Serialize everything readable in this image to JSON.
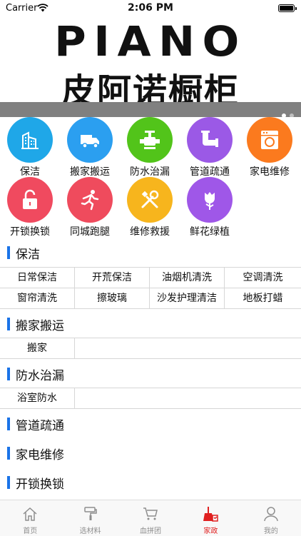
{
  "status": {
    "carrier": "Carrier",
    "time": "2:06 PM"
  },
  "banner": {
    "brand": "PIANO",
    "subtitle": "皮阿诺橱柜"
  },
  "services": [
    {
      "label": "保洁",
      "icon": "building-icon",
      "color": "#1fa7e8"
    },
    {
      "label": "搬家搬运",
      "icon": "truck-icon",
      "color": "#2b9ff0"
    },
    {
      "label": "防水治漏",
      "icon": "valve-icon",
      "color": "#52c41a"
    },
    {
      "label": "管道疏通",
      "icon": "pipe-icon",
      "color": "#9b59e6"
    },
    {
      "label": "家电维修",
      "icon": "washing-machine-icon",
      "color": "#fb7a1e"
    },
    {
      "label": "开锁换锁",
      "icon": "unlock-icon",
      "color": "#f04a5f"
    },
    {
      "label": "同城跑腿",
      "icon": "runner-icon",
      "color": "#ef4b5d"
    },
    {
      "label": "维修救援",
      "icon": "tools-icon",
      "color": "#f7b51d"
    },
    {
      "label": "鲜花绿植",
      "icon": "rose-icon",
      "color": "#9f57e8"
    }
  ],
  "sections": {
    "cleaning": {
      "title": "保洁",
      "rows": [
        [
          "日常保洁",
          "开荒保洁",
          "油烟机清洗",
          "空调清洗"
        ],
        [
          "窗帘清洗",
          "擦玻璃",
          "沙发护理清洁",
          "地板打蜡"
        ]
      ]
    },
    "moving": {
      "title": "搬家搬运",
      "rows": [
        [
          "搬家",
          ""
        ]
      ]
    },
    "waterproof": {
      "title": "防水治漏",
      "rows": [
        [
          "浴室防水",
          ""
        ]
      ]
    },
    "pipe": {
      "title": "管道疏通"
    },
    "appliance": {
      "title": "家电维修"
    },
    "lock": {
      "title": "开锁换锁"
    }
  },
  "tabs": [
    {
      "label": "首页",
      "icon": "home-icon",
      "active": false
    },
    {
      "label": "选材料",
      "icon": "paint-roller-icon",
      "active": false
    },
    {
      "label": "血拼团",
      "icon": "cart-icon",
      "active": false
    },
    {
      "label": "家政",
      "icon": "broom-icon",
      "active": true
    },
    {
      "label": "我的",
      "icon": "person-icon",
      "active": false
    }
  ],
  "colors": {
    "accent": "#1a73e8",
    "tab_active": "#e02020",
    "tab_inactive": "#8e8e8e"
  }
}
